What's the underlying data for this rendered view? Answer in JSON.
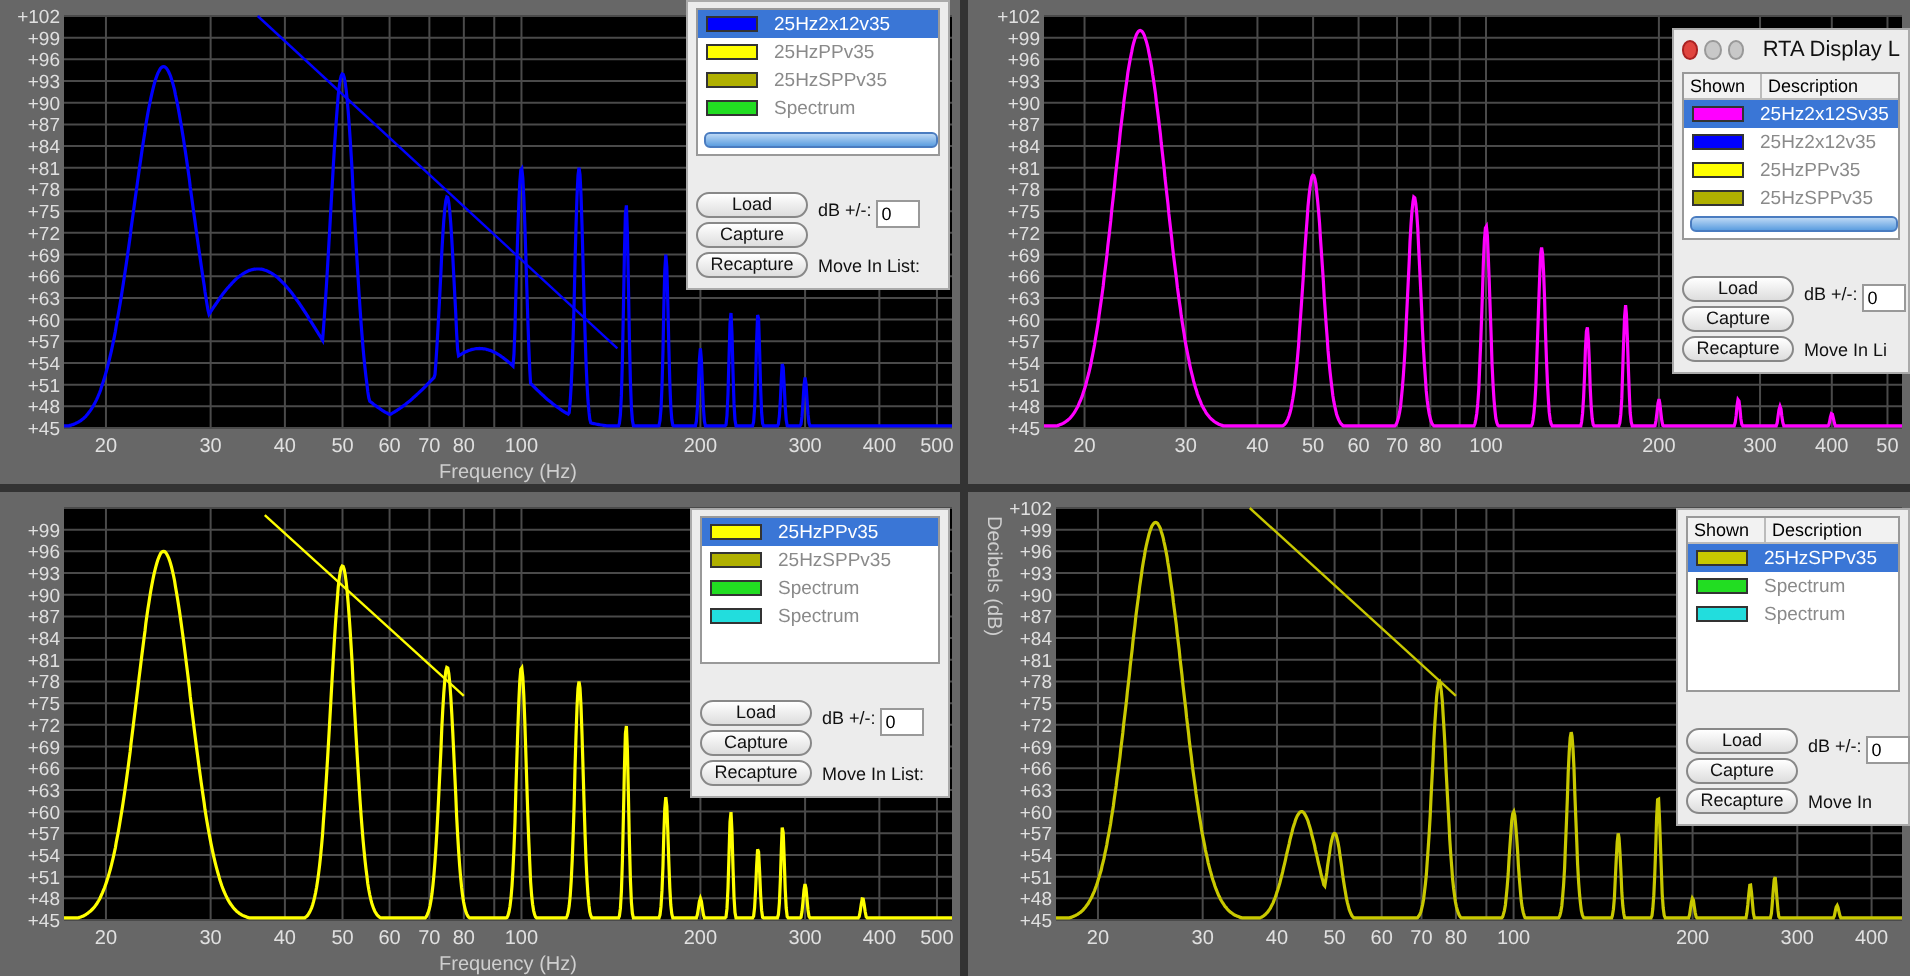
{
  "panels": [
    {
      "color": "#0000ff",
      "y_labels": [
        "+102",
        "+99",
        "+96",
        "+93",
        "+90",
        "+87",
        "+84",
        "+81",
        "+78",
        "+75",
        "+72",
        "+69",
        "+66",
        "+63",
        "+60",
        "+57",
        "+54",
        "+51",
        "+48",
        "+45"
      ],
      "x_labels": [
        "20",
        "30",
        "40",
        "50",
        "60",
        "70",
        "80",
        "100",
        "200",
        "300",
        "400",
        "500"
      ],
      "x_title": "Frequency (Hz)",
      "display_list": {
        "items": [
          {
            "label": "25Hz2x12v35",
            "color": "#0000ff",
            "selected": true
          },
          {
            "label": "25HzPPv35",
            "color": "#ffff00",
            "selected": false
          },
          {
            "label": "25HzSPPv35",
            "color": "#b0b000",
            "selected": false
          },
          {
            "label": "Spectrum",
            "color": "#22dd22",
            "selected": false
          }
        ],
        "buttons": [
          "Load",
          "Capture",
          "Recapture"
        ],
        "db_label": "dB +/-:",
        "db_value": "0",
        "move_label": "Move In List:"
      }
    },
    {
      "color": "#ff00ff",
      "y_labels": [
        "+102",
        "+99",
        "+96",
        "+93",
        "+90",
        "+87",
        "+84",
        "+81",
        "+78",
        "+75",
        "+72",
        "+69",
        "+66",
        "+63",
        "+60",
        "+57",
        "+54",
        "+51",
        "+48",
        "+45"
      ],
      "x_labels": [
        "20",
        "30",
        "40",
        "50",
        "60",
        "70",
        "80",
        "100",
        "200",
        "300",
        "400",
        "50"
      ],
      "display_list": {
        "title": "RTA Display L",
        "columns": [
          "Shown",
          "Description"
        ],
        "items": [
          {
            "label": "25Hz2x12Sv35",
            "color": "#ff00ff",
            "selected": true
          },
          {
            "label": "25Hz2x12v35",
            "color": "#0000ff",
            "selected": false
          },
          {
            "label": "25HzPPv35",
            "color": "#ffff00",
            "selected": false
          },
          {
            "label": "25HzSPPv35",
            "color": "#b0b000",
            "selected": false
          }
        ],
        "buttons": [
          "Load",
          "Capture",
          "Recapture"
        ],
        "db_label": "dB +/-:",
        "db_value": "0",
        "move_label": "Move In Li"
      }
    },
    {
      "color": "#ffff00",
      "y_labels": [
        "+99",
        "+96",
        "+93",
        "+90",
        "+87",
        "+84",
        "+81",
        "+78",
        "+75",
        "+72",
        "+69",
        "+66",
        "+63",
        "+60",
        "+57",
        "+54",
        "+51",
        "+48",
        "+45"
      ],
      "x_labels": [
        "20",
        "30",
        "40",
        "50",
        "60",
        "70",
        "80",
        "100",
        "200",
        "300",
        "400",
        "500"
      ],
      "x_title": "Frequency (Hz)",
      "display_list": {
        "items": [
          {
            "label": "25HzPPv35",
            "color": "#ffff00",
            "selected": true
          },
          {
            "label": "25HzSPPv35",
            "color": "#b0b000",
            "selected": false
          },
          {
            "label": "Spectrum",
            "color": "#22dd22",
            "selected": false
          },
          {
            "label": "Spectrum",
            "color": "#22dddd",
            "selected": false
          }
        ],
        "buttons": [
          "Load",
          "Capture",
          "Recapture"
        ],
        "db_label": "dB +/-:",
        "db_value": "0",
        "move_label": "Move In List:"
      }
    },
    {
      "color": "#c8c800",
      "y_title": "Decibels (dB)",
      "y_labels": [
        "+102",
        "+99",
        "+96",
        "+93",
        "+90",
        "+87",
        "+84",
        "+81",
        "+78",
        "+75",
        "+72",
        "+69",
        "+66",
        "+63",
        "+60",
        "+57",
        "+54",
        "+51",
        "+48",
        "+45"
      ],
      "x_labels": [
        "20",
        "30",
        "40",
        "50",
        "60",
        "70",
        "80",
        "100",
        "200",
        "300",
        "400"
      ],
      "display_list": {
        "columns": [
          "Shown",
          "Description"
        ],
        "items": [
          {
            "label": "25HzSPPv35",
            "color": "#c8c800",
            "selected": true
          },
          {
            "label": "Spectrum",
            "color": "#22dd22",
            "selected": false
          },
          {
            "label": "Spectrum",
            "color": "#22dddd",
            "selected": false
          }
        ],
        "buttons": [
          "Load",
          "Capture",
          "Recapture"
        ],
        "db_label": "dB +/-:",
        "db_value": "0",
        "move_label": "Move In"
      }
    }
  ]
}
